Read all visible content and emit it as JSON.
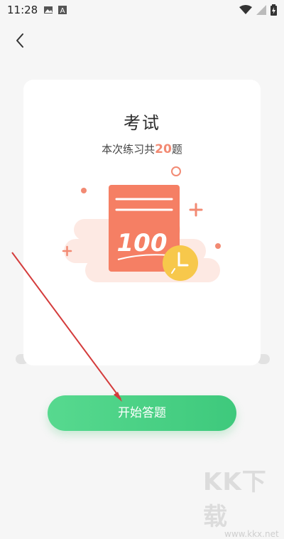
{
  "status_bar": {
    "time": "11:28",
    "left_icons": [
      "image-icon",
      "a-notification-icon"
    ],
    "right_icons": [
      "wifi-icon",
      "signal-icon",
      "battery-charging-icon"
    ]
  },
  "header": {
    "back_icon": "chevron-left-icon"
  },
  "card": {
    "title": "考试",
    "subtitle_prefix": "本次练习共",
    "question_count": "20",
    "subtitle_suffix": "题",
    "score_text": "100"
  },
  "actions": {
    "start_label": "开始答题"
  },
  "watermark": {
    "main": "KK下载",
    "sub": "www.kkx.net"
  },
  "colors": {
    "accent_green": "#3ec97c",
    "accent_orange": "#f28a73",
    "clock_yellow": "#f7c84b",
    "arrow_red": "#d43c3c"
  }
}
